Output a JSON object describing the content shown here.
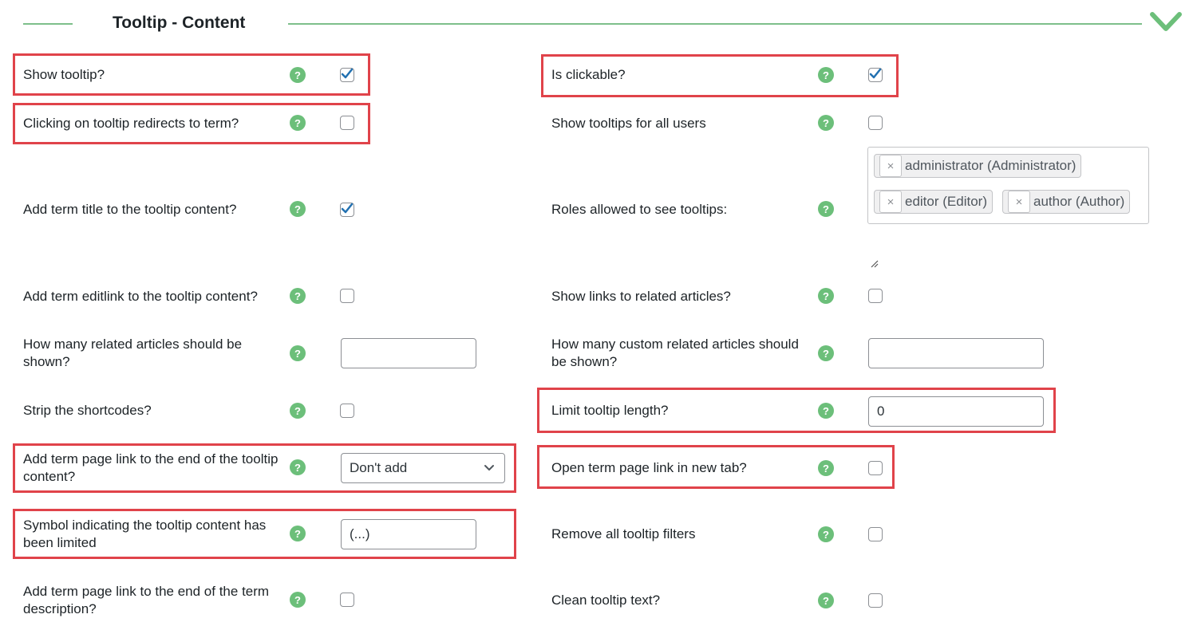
{
  "section": {
    "title": "Tooltip - Content"
  },
  "help_glyph": "?",
  "colors": {
    "accent_green": "#6cbf7a",
    "highlight_red": "#e0434a",
    "checkbox_blue": "#2271b1"
  },
  "left": {
    "show_tooltip": {
      "label": "Show tooltip?",
      "checked": true
    },
    "click_redirect": {
      "label": "Clicking on tooltip redirects to term?",
      "checked": false
    },
    "add_title": {
      "label": "Add term title to the tooltip content?",
      "checked": true
    },
    "add_editlink": {
      "label": "Add term editlink to the tooltip content?",
      "checked": false
    },
    "related_count": {
      "label": "How many related articles should be shown?",
      "value": ""
    },
    "strip_shortcodes": {
      "label": "Strip the shortcodes?",
      "checked": false
    },
    "add_page_link": {
      "label": "Add term page link to the end of the tooltip content?",
      "selected": "Don't add"
    },
    "limit_symbol": {
      "label": "Symbol indicating the tooltip content has been limited",
      "value": "(...)"
    },
    "desc_link": {
      "label": "Add term page link to the end of the term description?",
      "checked": false
    }
  },
  "right": {
    "clickable": {
      "label": "Is clickable?",
      "checked": true
    },
    "all_users": {
      "label": "Show tooltips for all users",
      "checked": false
    },
    "roles": {
      "label": "Roles allowed to see tooltips:",
      "remove_glyph": "×",
      "tags": [
        "administrator (Administrator)",
        "editor (Editor)",
        "author (Author)"
      ]
    },
    "related_links": {
      "label": "Show links to related articles?",
      "checked": false
    },
    "custom_related_count": {
      "label": "How many custom related articles should be shown?",
      "value": ""
    },
    "limit_length": {
      "label": "Limit tooltip length?",
      "value": "0"
    },
    "new_tab": {
      "label": "Open term page link in new tab?",
      "checked": false
    },
    "remove_filters": {
      "label": "Remove all tooltip filters",
      "checked": false
    },
    "clean_text": {
      "label": "Clean tooltip text?",
      "checked": false
    }
  }
}
